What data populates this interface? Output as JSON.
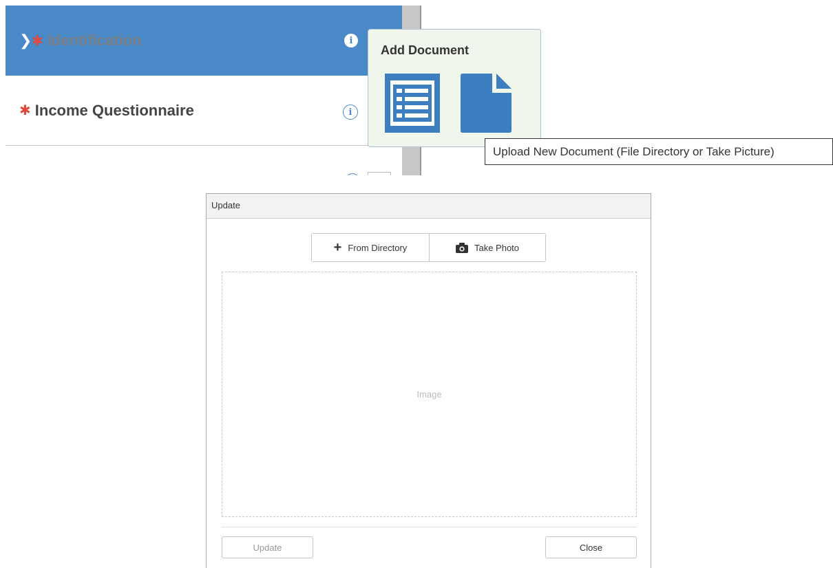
{
  "documents": {
    "items": [
      {
        "label": "Identification",
        "required": "✱"
      },
      {
        "label": "Income Questionnaire",
        "required": "✱"
      }
    ],
    "info_glyph": "i",
    "expand_icon": "chevron-right-icon"
  },
  "popover": {
    "title": "Add Document",
    "icons": [
      "list-document-icon",
      "file-document-icon"
    ],
    "tooltip": "Upload New Document (File Directory or Take Picture)"
  },
  "dialog": {
    "title": "Update",
    "from_directory": "From Directory",
    "take_photo": "Take Photo",
    "image_placeholder": "Image",
    "update_button": "Update",
    "close_button": "Close"
  },
  "colors": {
    "primary": "#4a89c8",
    "required": "#e0493c",
    "popover_bg": "#f0f6ec"
  }
}
